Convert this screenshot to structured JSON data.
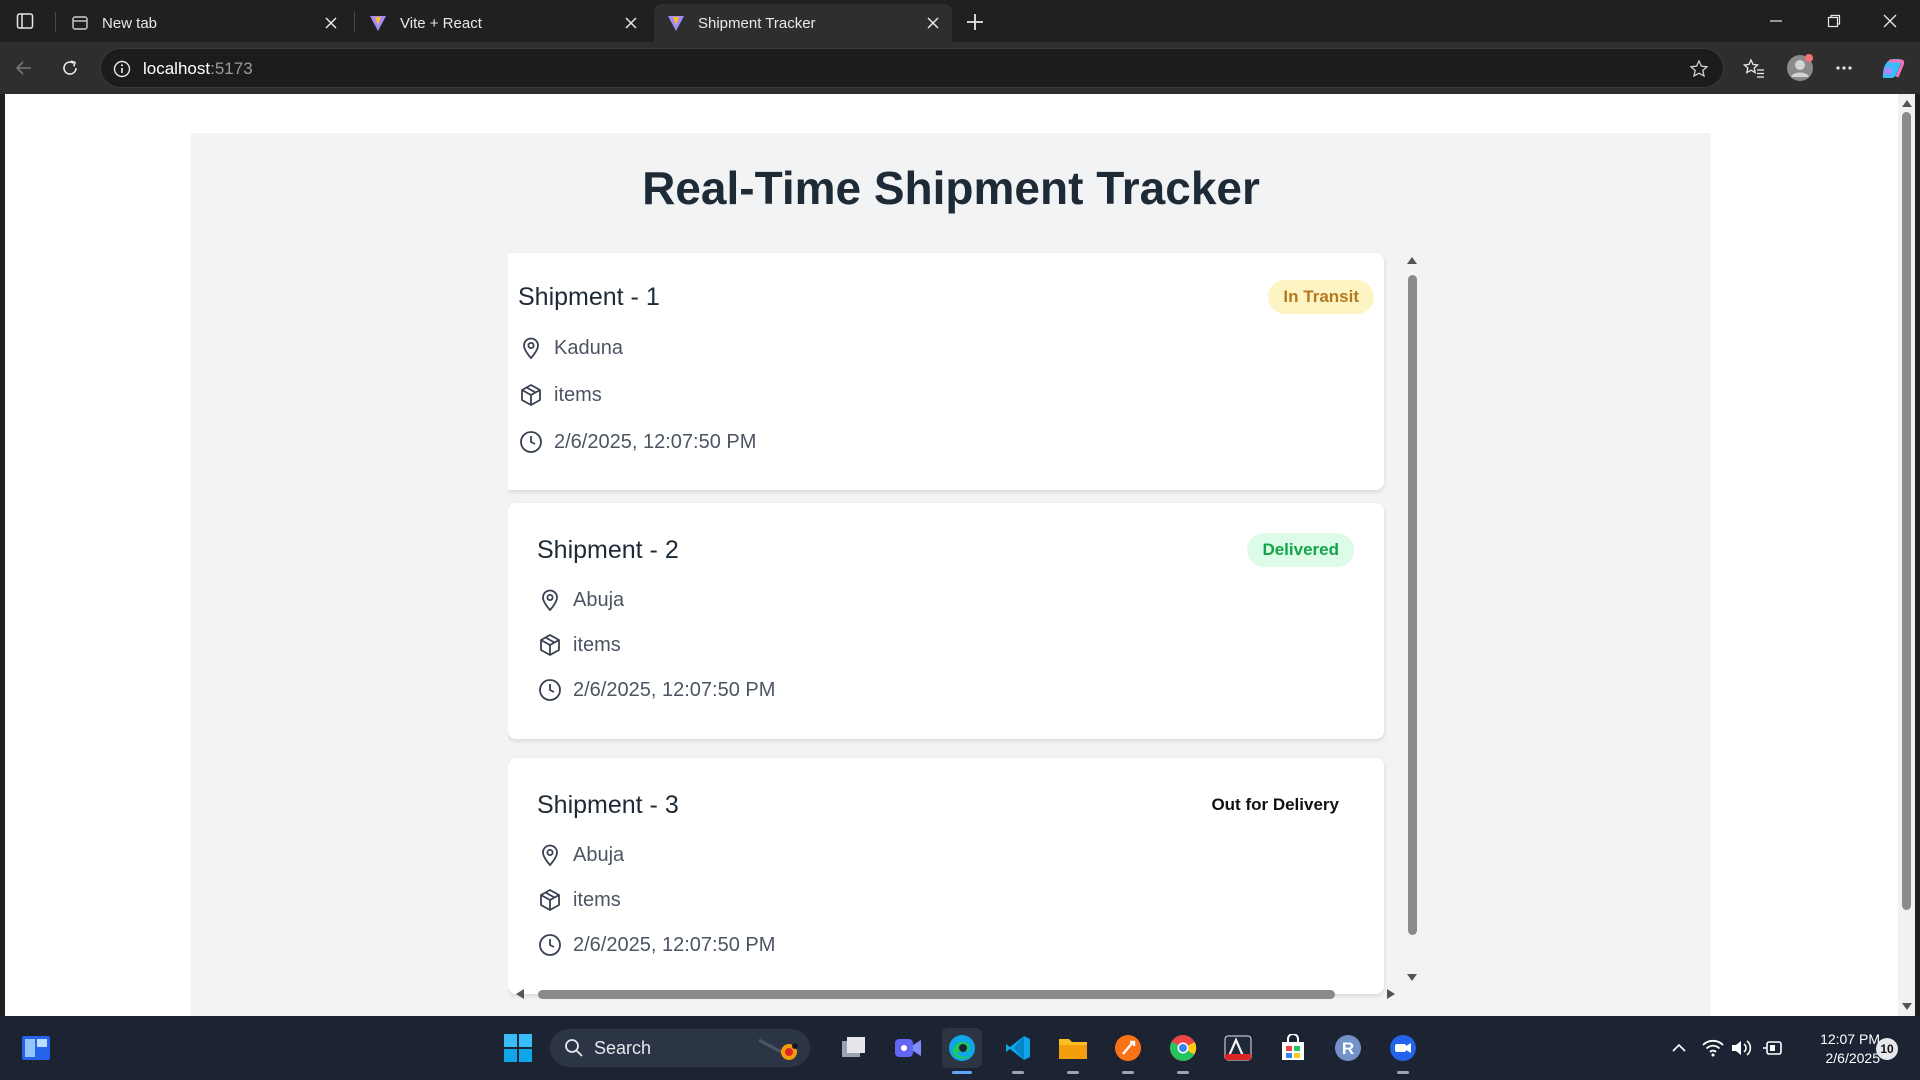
{
  "browser": {
    "tabs": [
      {
        "title": "New tab",
        "favicon": "new-tab-icon"
      },
      {
        "title": "Vite + React",
        "favicon": "vite-icon"
      },
      {
        "title": "Shipment Tracker",
        "favicon": "vite-icon",
        "active": true
      }
    ],
    "url": {
      "host": "localhost",
      "port": ":5173"
    }
  },
  "app": {
    "title": "Real-Time Shipment Tracker",
    "shipments": [
      {
        "name": "Shipment - 1",
        "status": "In Transit",
        "location": "Kaduna",
        "items": "items",
        "time": "2/6/2025, 12:07:50 PM"
      },
      {
        "name": "Shipment - 2",
        "status": "Delivered",
        "location": "Abuja",
        "items": "items",
        "time": "2/6/2025, 12:07:50 PM"
      },
      {
        "name": "Shipment - 3",
        "status": "Out for Delivery",
        "location": "Abuja",
        "items": "items",
        "time": "2/6/2025, 12:07:50 PM"
      }
    ]
  },
  "taskbar": {
    "search_label": "Search",
    "clock_time": "12:07 PM",
    "clock_date": "2/6/2025",
    "notification_count": "10"
  },
  "colors": {
    "page_bg": "#f2f3f5",
    "title": "#1f2a37",
    "in_transit_bg": "#fdf4c4",
    "in_transit_text": "#b7791f",
    "delivered_bg": "#dcfce7",
    "delivered_text": "#16a34a"
  }
}
